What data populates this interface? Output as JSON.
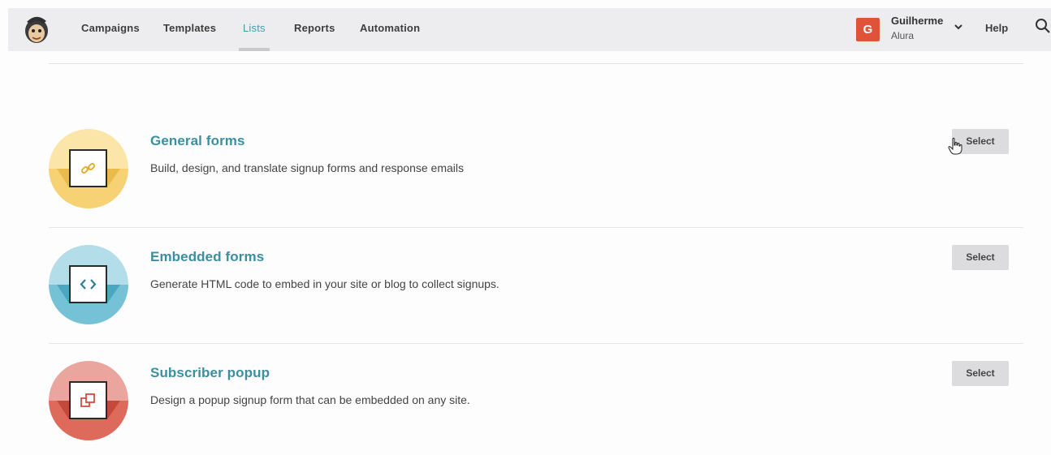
{
  "nav": {
    "items": [
      {
        "label": "Campaigns"
      },
      {
        "label": "Templates"
      },
      {
        "label": "Lists"
      },
      {
        "label": "Reports"
      },
      {
        "label": "Automation"
      }
    ],
    "active": "Lists",
    "logo_icon": "freddie-monkey-logo-icon"
  },
  "user": {
    "avatar_initial": "G",
    "avatar_color": "#e0533a",
    "name": "Guilherme",
    "org": "Alura"
  },
  "help_label": "Help",
  "accent_color": "#3a8fa0",
  "forms": [
    {
      "title": "General forms",
      "description": "Build, design, and translate signup forms and response emails",
      "icon": "link-icon",
      "circle_color": "#f8d57e",
      "button_label": "Select"
    },
    {
      "title": "Embedded forms",
      "description": "Generate HTML code to embed in your site or blog to collect signups.",
      "icon": "code-icon",
      "circle_color": "#7cc6d9",
      "button_label": "Select"
    },
    {
      "title": "Subscriber popup",
      "description": "Design a popup signup form that can be embedded on any site.",
      "icon": "popup-icon",
      "circle_color": "#e07364",
      "button_label": "Select"
    }
  ]
}
